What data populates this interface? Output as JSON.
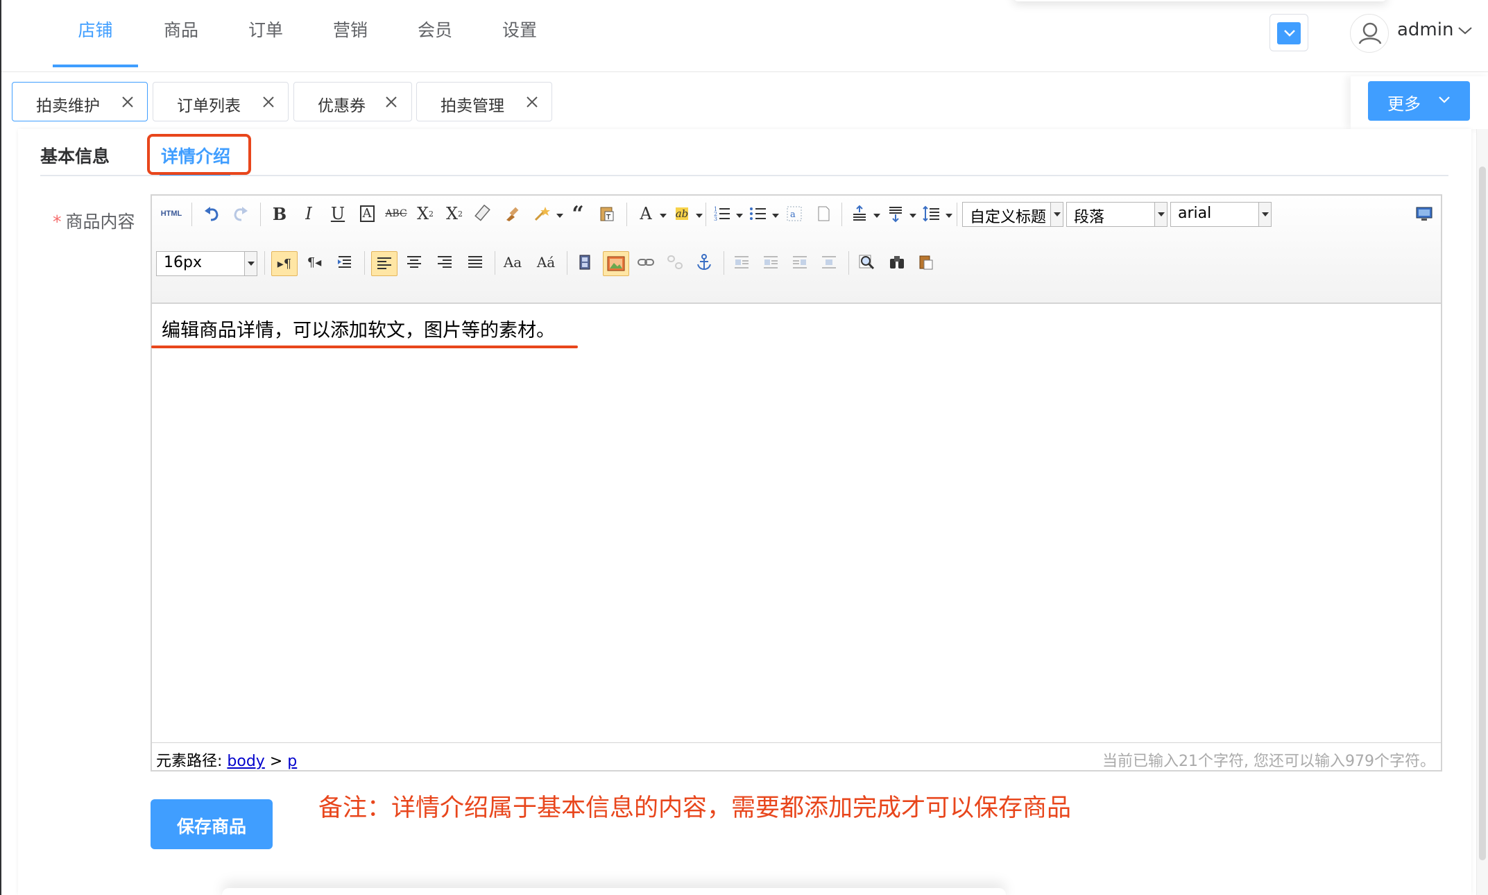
{
  "nav": {
    "items": [
      {
        "label": "店铺",
        "active": true
      },
      {
        "label": "商品",
        "active": false
      },
      {
        "label": "订单",
        "active": false
      },
      {
        "label": "营销",
        "active": false
      },
      {
        "label": "会员",
        "active": false
      },
      {
        "label": "设置",
        "active": false
      }
    ],
    "username": "admin",
    "accent": "#409eff"
  },
  "tabs": {
    "items": [
      {
        "label": "拍卖维护",
        "active": true
      },
      {
        "label": "订单列表",
        "active": false
      },
      {
        "label": "优惠券",
        "active": false
      },
      {
        "label": "拍卖管理",
        "active": false
      }
    ],
    "more_label": "更多"
  },
  "subtabs": {
    "basic": "基本信息",
    "detail": "详情介绍"
  },
  "form": {
    "required_mark": "*",
    "content_label": "商品内容"
  },
  "editor": {
    "html_button": "HTML",
    "selects": {
      "heading_style": "自定义标题",
      "paragraph": "段落",
      "font_family": "arial",
      "font_size": "16px"
    },
    "body_text": "编辑商品详情，可以添加软文，图片等的素材。",
    "path_label": "元素路径:",
    "path_body": "body",
    "path_sep": ">",
    "path_p": "p",
    "word_count": "当前已输入21个字符, 您还可以输入979个字符。"
  },
  "actions": {
    "save_label": "保存商品"
  },
  "annotation": {
    "note": "备注：详情介绍属于基本信息的内容，需要都添加完成才可以保存商品",
    "color": "#e8461c"
  }
}
